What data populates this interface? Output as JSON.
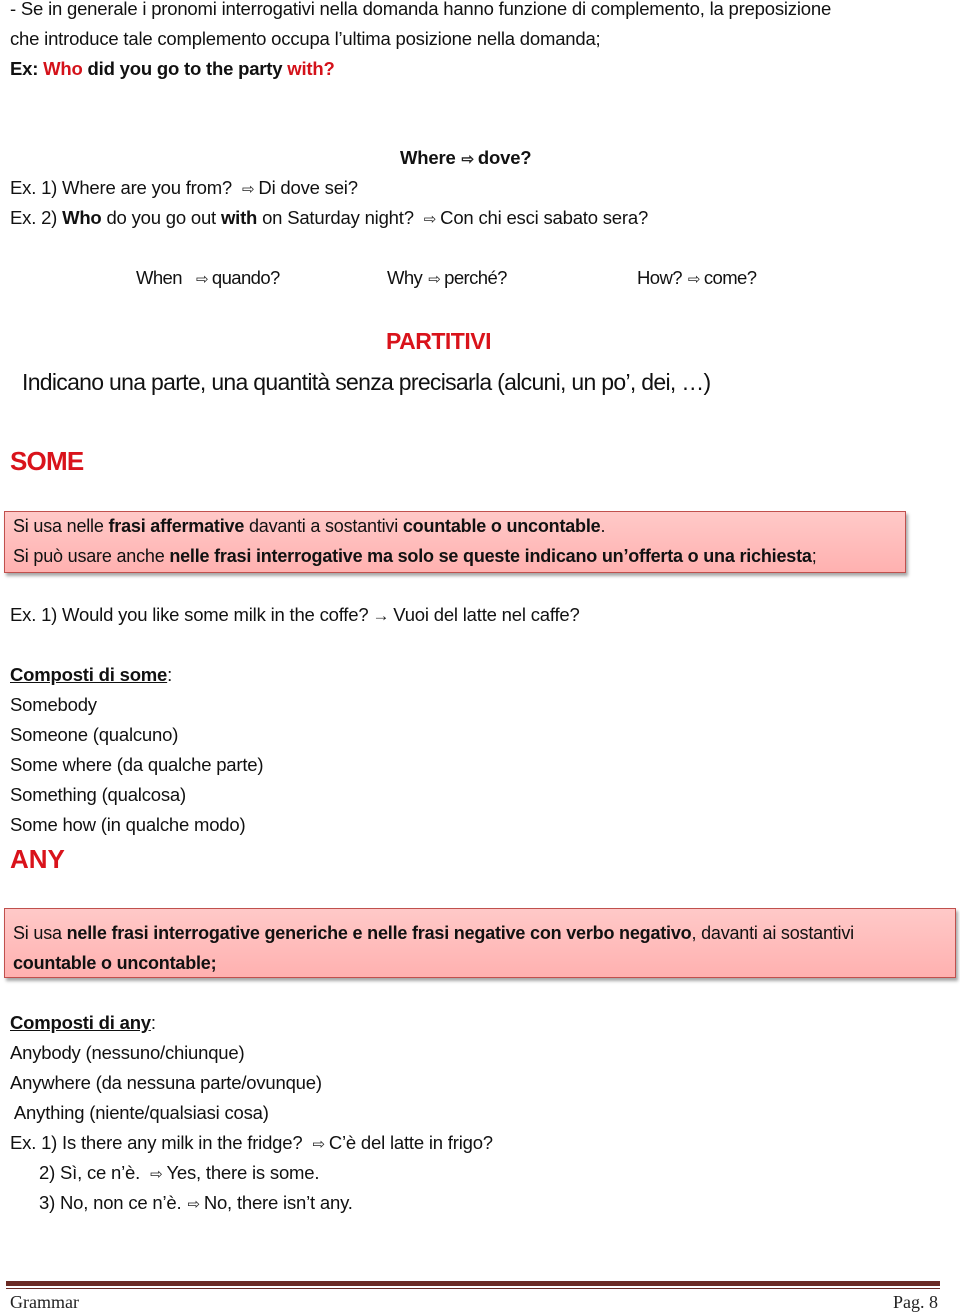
{
  "intro": {
    "line1": "- Se in generale i pronomi interrogativi nella domanda hanno funzione di complemento, la preposizione",
    "line2": "che introduce tale complemento occupa l’ultima posizione nella domanda;",
    "example_prefix": "Ex: ",
    "example_who": "Who",
    "example_mid": " did you go to the party ",
    "example_with": "with?"
  },
  "where_row": {
    "en": "Where",
    "it": "dove?"
  },
  "examples_where": [
    {
      "prefix": "Ex. 1) Where are you from?",
      "translation": "Di dove sei?"
    },
    {
      "p1": "Ex. 2) ",
      "who": "Who",
      "p2": " do you go out ",
      "with": "with",
      "p3": " on Saturday night?",
      "translation": "Con chi esci sabato sera?"
    }
  ],
  "question_words": [
    {
      "en": "When",
      "it": "quando?"
    },
    {
      "en": "Why",
      "it": "perché?"
    },
    {
      "en": "How?",
      "it": "come?"
    }
  ],
  "partitivi": {
    "title": "PARTITIVI",
    "description": "Indicano una parte, una quantità senza precisarla (alcuni, un po’, dei, …)"
  },
  "some": {
    "heading": "SOME",
    "box": {
      "l1_a": "Si usa nelle ",
      "l1_b": "frasi affermative",
      "l1_c": " davanti a sostantivi ",
      "l1_d": "countable o uncontable",
      "l1_e": ".",
      "l2_a": "Si può usare anche ",
      "l2_b": "nelle frasi interrogative ma solo se queste indicano un’offerta o una richiesta",
      "l2_c": ";"
    },
    "example": "Ex. 1) Would you like some milk in the coffe?",
    "example_translation": "Vuoi del latte nel caffe?",
    "compounds_title": "Composti di some",
    "compounds_colon": ":",
    "compounds": [
      "Somebody",
      "Someone (qualcuno)",
      "Some where (da qualche parte)",
      "Something (qualcosa)",
      "Some how (in qualche modo)"
    ]
  },
  "any": {
    "heading": "ANY",
    "box": {
      "l1_a": "Si usa ",
      "l1_b": "nelle frasi interrogative generiche e nelle frasi negative con verbo negativo",
      "l1_c": ", davanti ai sostantivi",
      "l2": "countable o uncontable;"
    },
    "compounds_title": "Composti di any",
    "compounds_colon": ":",
    "compounds": [
      "Anybody (nessuno/chiunque)",
      "Anywhere (da nessuna parte/ovunque)",
      " Anything (niente/qualsiasi cosa)"
    ],
    "examples": [
      {
        "q": "Ex. 1) Is there any milk in the fridge?",
        "a": "C’è del latte in frigo?"
      },
      {
        "q": "2) Sì, ce n’è.",
        "a": "Yes, there is some."
      },
      {
        "q": "3) No, non ce n’è.",
        "a": "No, there isn’t any."
      }
    ]
  },
  "icons": {
    "hollow_arrow": "⇨",
    "solid_arrow": "→"
  },
  "footer": {
    "left": "Grammar",
    "right": "Pag. 8"
  }
}
